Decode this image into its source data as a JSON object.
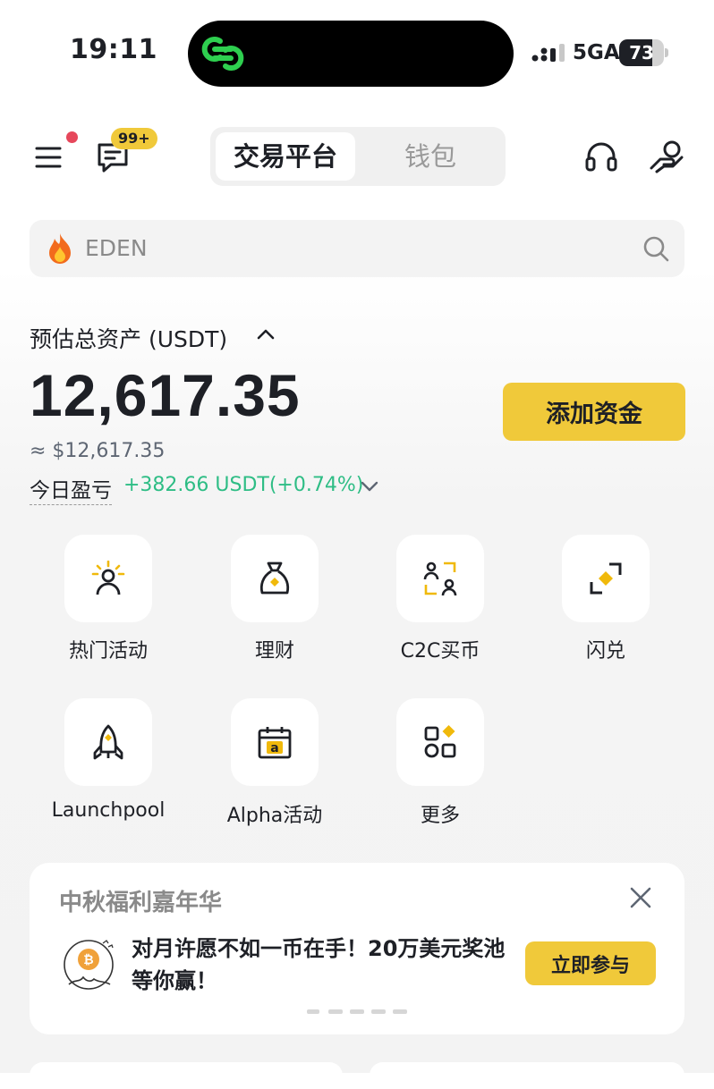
{
  "status_bar": {
    "time": "19:11",
    "network": "5GA",
    "battery": "73",
    "battery_level": 0.73
  },
  "header": {
    "message_badge": "99+",
    "tabs": [
      {
        "label": "交易平台",
        "active": true
      },
      {
        "label": "钱包",
        "active": false
      }
    ]
  },
  "search": {
    "placeholder": "EDEN"
  },
  "assets": {
    "label": "预估总资产 (USDT)",
    "balance": "12,617.35",
    "fiat_equivalent": "≈ $12,617.35",
    "pnl_label": "今日盈亏",
    "pnl_value": "+382.66 USDT(+0.74%)",
    "add_funds": "添加资金"
  },
  "shortcuts": [
    {
      "label": "热门活动",
      "icon": "hot-activity-icon"
    },
    {
      "label": "理财",
      "icon": "money-bag-icon"
    },
    {
      "label": "C2C买币",
      "icon": "c2c-users-icon"
    },
    {
      "label": "闪兑",
      "icon": "convert-icon"
    },
    {
      "label": "Launchpool",
      "icon": "rocket-icon"
    },
    {
      "label": "Alpha活动",
      "icon": "calendar-alpha-icon"
    },
    {
      "label": "更多",
      "icon": "more-grid-icon"
    }
  ],
  "promo": {
    "title": "中秋福利嘉年华",
    "text": "对月许愿不如一币在手！20万美元奖池等你赢！",
    "button": "立即参与"
  },
  "colors": {
    "accent": "#F0C93A",
    "positive": "#2EBD85",
    "badge_red": "#E6475B",
    "text": "#1E2026"
  }
}
